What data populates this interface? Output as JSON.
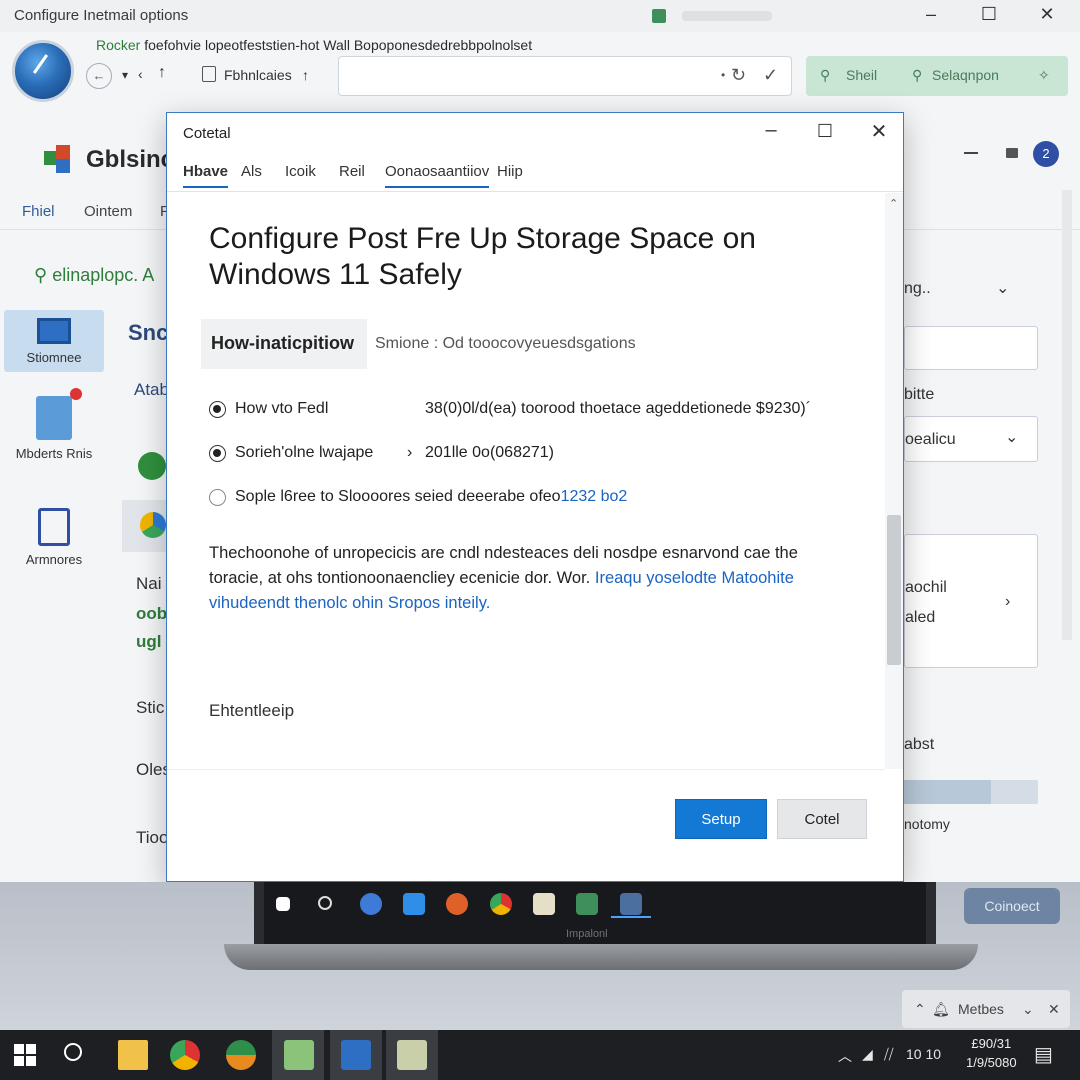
{
  "background_window": {
    "title": "Configure Inetmail options",
    "subtitle_prefix": "Rocker",
    "subtitle_rest": "foefohvie lopeotfeststien-hot Wall Bopoponesdedrebbpolnolset",
    "tab_label": "Fbhnlcaies",
    "search_labels": [
      "Sheil",
      "Selaqnpon"
    ],
    "app_name": "Gblsinc",
    "menu_items": [
      "Fhiel",
      "Ointem",
      "F"
    ],
    "search_text": "elinaplopc. A",
    "rail_items": [
      "Stiomnee",
      "Mbderts Rnis",
      "Armnores"
    ],
    "mid_column": [
      "Snc",
      "Atab",
      "Nai",
      "oob",
      "ugl",
      "Stic",
      "Oles",
      "Tioo"
    ],
    "right_column": [
      "ng..",
      "bitte",
      "oealicu",
      "aochil",
      "aled",
      "abst",
      "notomy"
    ],
    "progress_fraction": 0.65,
    "avatar_initial": "2"
  },
  "dialog": {
    "title": "Cotetal",
    "tabs": [
      "Hbave",
      "Als",
      "Icoik",
      "Reil",
      "Oonaosaantiiov",
      "Hiip"
    ],
    "heading": "Configure Post Fre  Up Storage Space on Windows 11 Safely",
    "field_label": "How-inaticpitiow",
    "field_value": "Smione : Od tooocovyeuesdsgations",
    "options": [
      {
        "label": "How vto Fedl",
        "value": "38(0)0l/d(ea) toorood thoetace ageddetionede $9230)´",
        "value_link": "",
        "checked": true
      },
      {
        "label": "Sorieh'olne lwajape",
        "value": "201lle 0o(068271)",
        "value_link": "",
        "checked": true
      },
      {
        "label": "Sople l6ree to Sloooores seied deeerabe ofeo",
        "value": "",
        "value_link": "1232 bo2",
        "checked": false
      }
    ],
    "paragraph_text": "Thechoonohe of unropecicis are cndl ndesteaces deli nosdpe esnarvond cae the toracie, at ohs tontionoonaencliey ecenicie dor. Wor.",
    "paragraph_link": "Ireaqu yoselodte Matoohite vihudeendt thenolc ohin Sropos inteily.",
    "footnote": "Ehtentleeip",
    "primary_button": "Setup",
    "secondary_button": "Cotel"
  },
  "laptop": {
    "brand": "Impalonl",
    "connect_button": "Coinoect",
    "notification": "Metbes"
  },
  "taskbar": {
    "tray_text": "10  10",
    "clock_line1": "£90/31",
    "clock_line2": "1/9/5080"
  },
  "colors": {
    "accent": "#1479d4",
    "link": "#1a64c2",
    "green_text": "#2f7d3d",
    "taskbar": "#1d1f23"
  }
}
